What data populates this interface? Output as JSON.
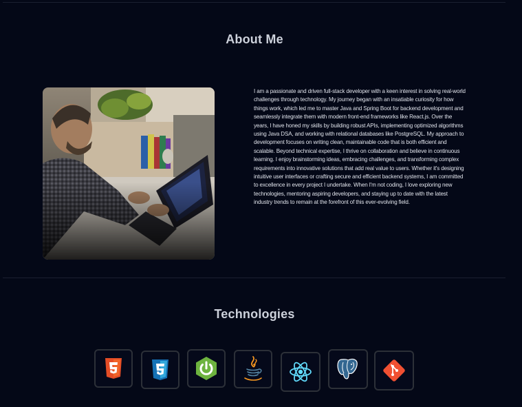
{
  "about": {
    "title": "About Me",
    "bio": "I am a passionate and driven full-stack developer with a keen interest in solving real-world challenges through technology. My journey began with an insatiable curiosity for how things work, which led me to master Java and Spring Boot for backend development and seamlessly integrate them with modern front-end frameworks like React.js. Over the years, I have honed my skills by building robust APIs, implementing optimized algorithms using Java DSA, and working with relational databases like PostgreSQL. My approach to development focuses on writing clean, maintainable code that is both efficient and scalable. Beyond technical expertise, I thrive on collaboration and believe in continuous learning. I enjoy brainstorming ideas, embracing challenges, and transforming complex requirements into innovative solutions that add real value to users. Whether it's designing intuitive user interfaces or crafting secure and efficient backend systems, I am committed to excellence in every project I undertake. When I'm not coding, I love exploring new technologies, mentoring aspiring developers, and staying up to date with the latest industry trends to remain at the forefront of this ever-evolving field."
  },
  "technologies": {
    "title": "Technologies",
    "items": [
      {
        "name": "html5-icon",
        "color": "#e44d26"
      },
      {
        "name": "css3-icon",
        "color": "#1572b6"
      },
      {
        "name": "spring-icon",
        "color": "#6db33f"
      },
      {
        "name": "java-icon",
        "color": "#f89820"
      },
      {
        "name": "react-icon",
        "color": "#61dafb"
      },
      {
        "name": "postgresql-icon",
        "color": "#336791"
      },
      {
        "name": "git-icon",
        "color": "#f05032"
      }
    ]
  }
}
